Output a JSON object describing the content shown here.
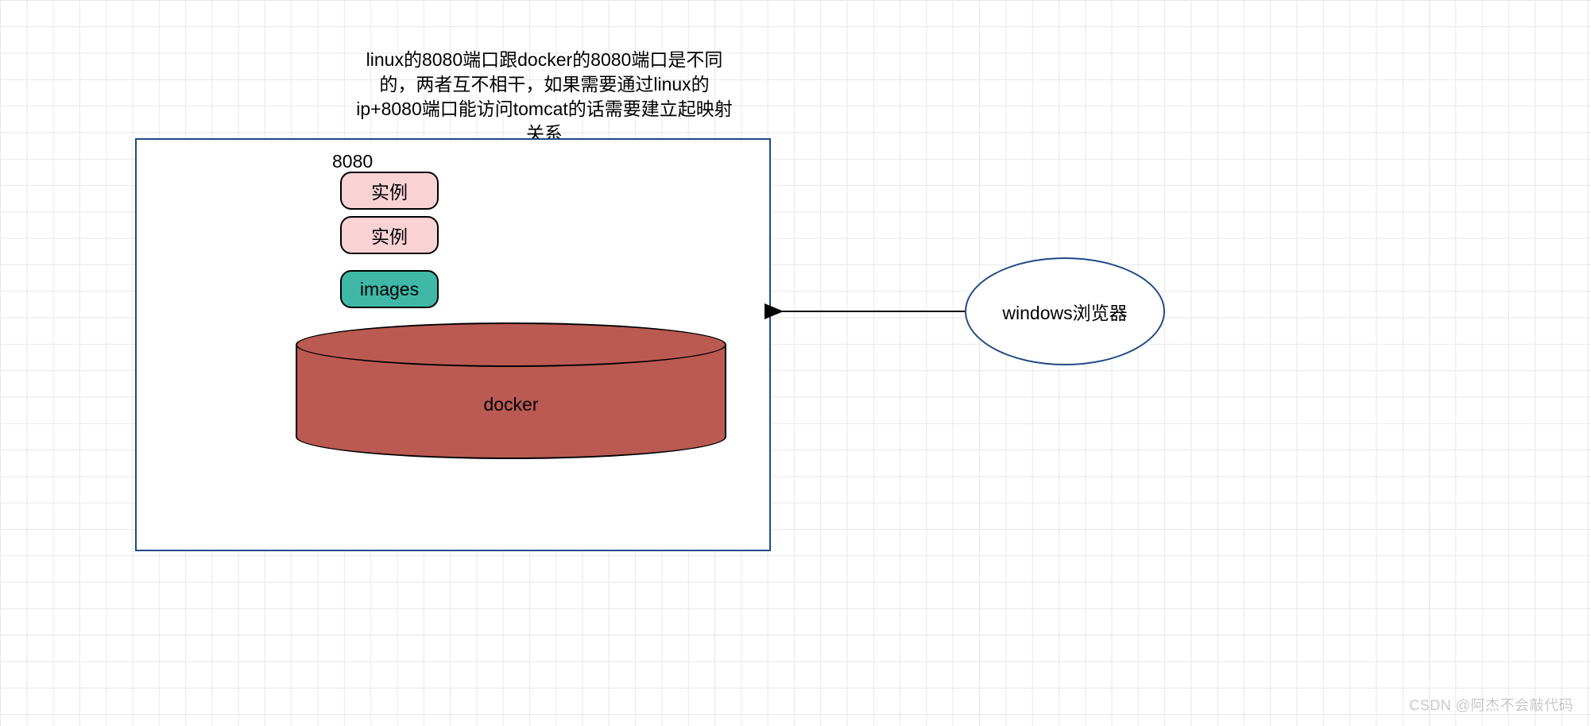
{
  "explanation": "linux的8080端口跟docker的8080端口是不同的，两者互不相干，如果需要通过linux的ip+8080端口能访问tomcat的话需要建立起映射关系",
  "hostBox": {
    "portLabel": "8080",
    "instance1": "实例",
    "instance2": "实例",
    "imagesLabel": "images",
    "cylinderLabel": "docker"
  },
  "browserNode": "windows浏览器",
  "watermark": "CSDN @阿杰不会敲代码"
}
